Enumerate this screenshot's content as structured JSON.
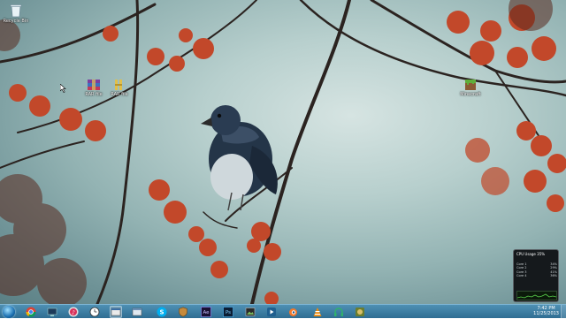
{
  "desktop": {
    "icons": [
      {
        "label": "Recycle Bin",
        "icon": "recycle-bin-icon"
      },
      {
        "label": "RAR file",
        "icon": "winrar-archive-icon"
      },
      {
        "label": "RAR file",
        "icon": "winrar-archive-icon"
      },
      {
        "label": "Minecraft",
        "icon": "minecraft-grass-block-icon"
      }
    ]
  },
  "taskbar": {
    "apps": [
      {
        "name": "Google Chrome",
        "icon": "chrome-icon"
      },
      {
        "name": "Monitor",
        "icon": "monitor-icon"
      },
      {
        "name": "iTunes",
        "icon": "itunes-icon"
      },
      {
        "name": "Clock",
        "icon": "clock-icon"
      },
      {
        "name": "Desktop window",
        "icon": "window-icon"
      },
      {
        "name": "Window",
        "icon": "window-icon"
      },
      {
        "name": "Skype",
        "icon": "skype-icon"
      },
      {
        "name": "Shield",
        "icon": "shield-icon"
      },
      {
        "name": "After Effects",
        "icon": "after-effects-icon"
      },
      {
        "name": "Photoshop",
        "icon": "photoshop-icon"
      },
      {
        "name": "Image viewer",
        "icon": "image-icon"
      },
      {
        "name": "Media",
        "icon": "media-icon"
      },
      {
        "name": "Blender",
        "icon": "blender-icon"
      },
      {
        "name": "VLC",
        "icon": "vlc-icon"
      },
      {
        "name": "Headphones",
        "icon": "headphones-icon"
      },
      {
        "name": "Game",
        "icon": "game-icon"
      }
    ],
    "clock": {
      "time": "7:42 PM",
      "date": "11/25/2013"
    }
  },
  "cpu_gadget": {
    "title": "CPU Usage",
    "usage": "35%",
    "cores": [
      {
        "label": "Core 1",
        "value": "34%"
      },
      {
        "label": "Core 2",
        "value": "29%"
      },
      {
        "label": "Core 3",
        "value": "41%"
      },
      {
        "label": "Core 4",
        "value": "36%"
      }
    ]
  },
  "colors": {
    "taskbar": "#3a7ea6",
    "accent": "#1b6fb0",
    "berry": "#c2482a"
  }
}
